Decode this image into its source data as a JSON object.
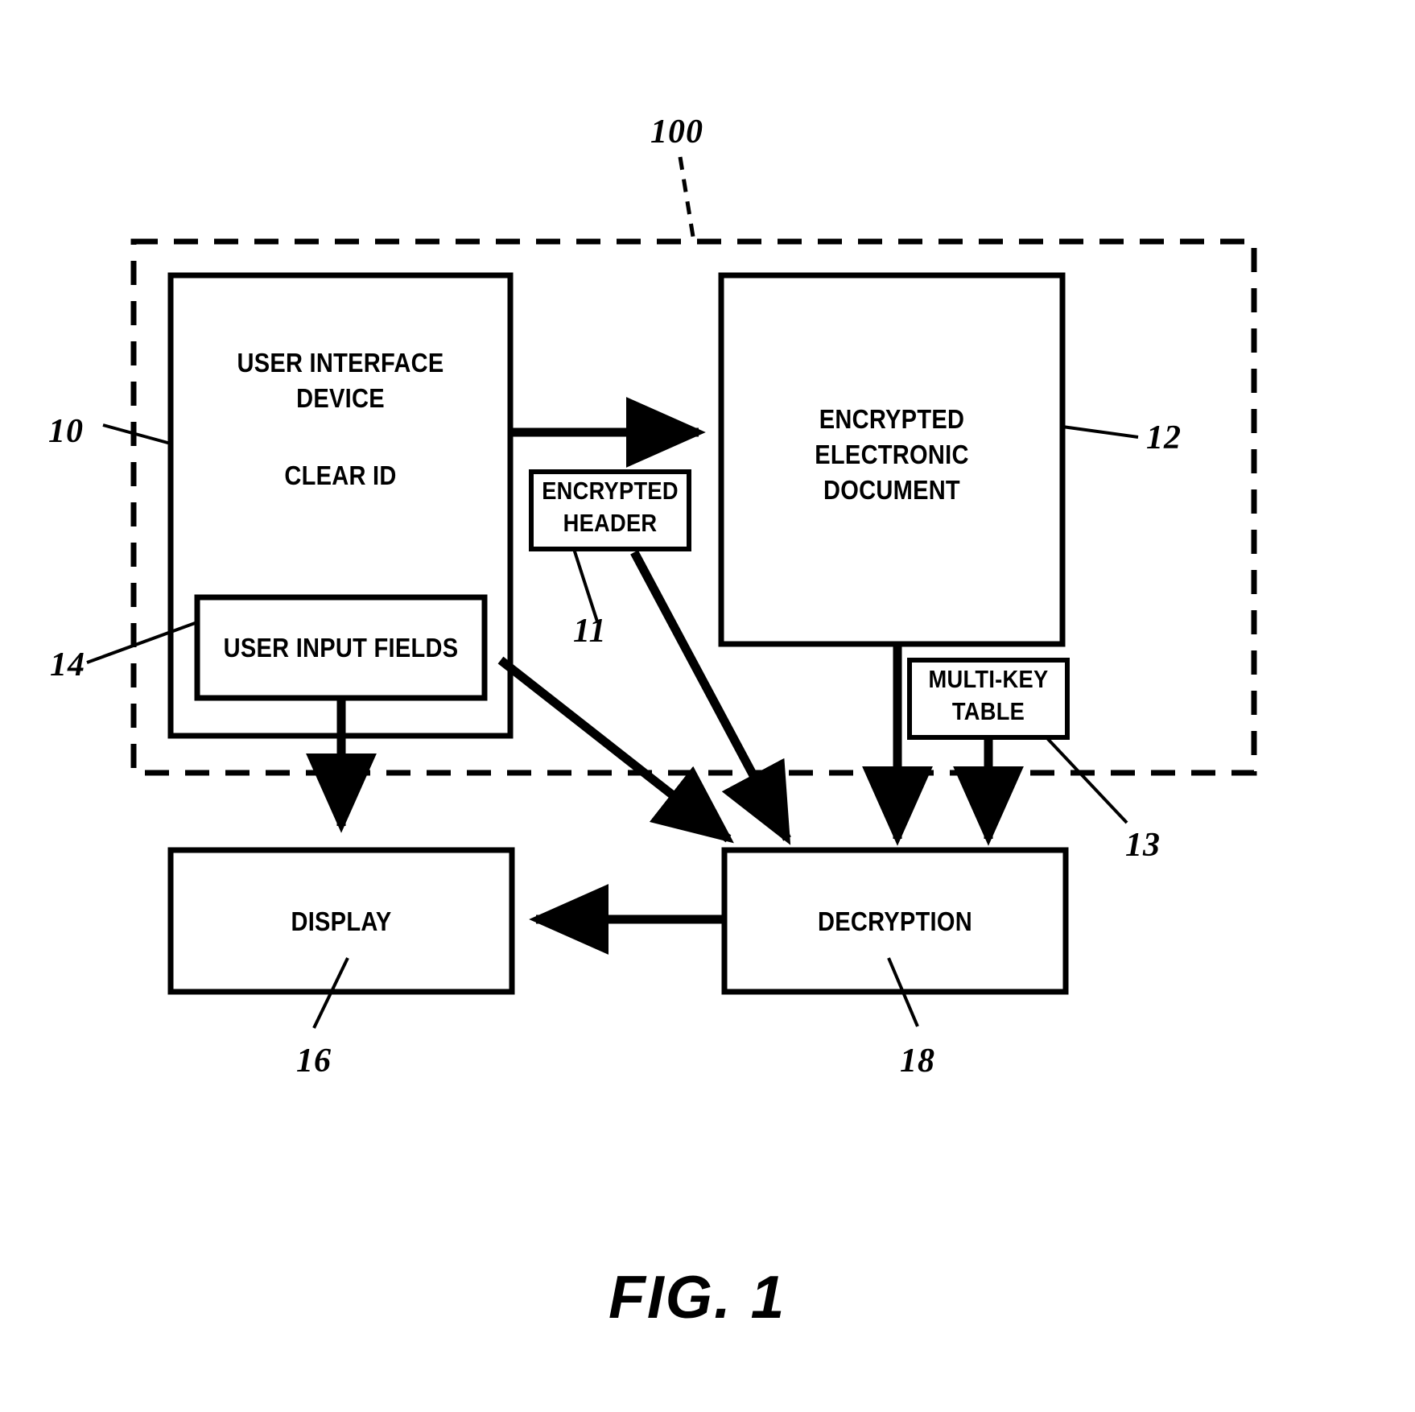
{
  "figure": {
    "caption": "FIG. 1",
    "type": "patent-block-diagram"
  },
  "boundary": {
    "ref": "100",
    "style": "dashed"
  },
  "blocks": [
    {
      "id": "user-interface-device",
      "ref": "10",
      "lines": [
        "USER INTERFACE",
        "DEVICE"
      ],
      "secondary_lines": [
        "CLEAR ID"
      ]
    },
    {
      "id": "encrypted-electronic-document",
      "ref": "12",
      "lines": [
        "ENCRYPTED",
        "ELECTRONIC",
        "DOCUMENT"
      ]
    },
    {
      "id": "encrypted-header",
      "ref": "11",
      "lines": [
        "ENCRYPTED",
        "HEADER"
      ]
    },
    {
      "id": "user-input-fields",
      "ref": "14",
      "lines": [
        "USER INPUT FIELDS"
      ]
    },
    {
      "id": "multi-key-table",
      "ref": "13",
      "lines": [
        "MULTI-KEY",
        "TABLE"
      ]
    },
    {
      "id": "display",
      "ref": "16",
      "lines": [
        "DISPLAY"
      ]
    },
    {
      "id": "decryption",
      "ref": "18",
      "lines": [
        "DECRYPTION"
      ]
    }
  ],
  "labels": {
    "user_interface_device_line1": "USER INTERFACE",
    "user_interface_device_line2": "DEVICE",
    "clear_id": "CLEAR ID",
    "encrypted_header_line1": "ENCRYPTED",
    "encrypted_header_line2": "HEADER",
    "encrypted_doc_line1": "ENCRYPTED",
    "encrypted_doc_line2": "ELECTRONIC",
    "encrypted_doc_line3": "DOCUMENT",
    "user_input_fields": "USER INPUT FIELDS",
    "multi_key_table_line1": "MULTI-KEY",
    "multi_key_table_line2": "TABLE",
    "display": "DISPLAY",
    "decryption": "DECRYPTION"
  },
  "reference_numerals": {
    "system": "100",
    "user_interface_device": "10",
    "encrypted_header": "11",
    "encrypted_electronic_document": "12",
    "multi_key_table": "13",
    "user_input_fields": "14",
    "display": "16",
    "decryption": "18"
  },
  "colors": {
    "ink": "#000000",
    "paper": "#ffffff"
  }
}
